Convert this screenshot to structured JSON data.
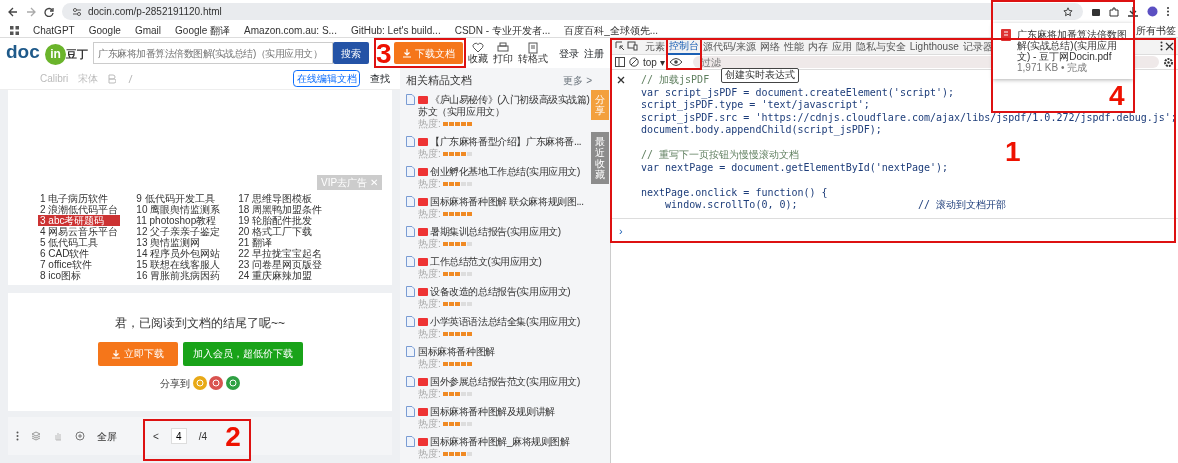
{
  "browser": {
    "url": "docin.com/p-2852191120.html",
    "bookmarks": [
      "ChatGPT",
      "Google",
      "Gmail",
      "Google 翻译",
      "Amazon.com.au: S...",
      "GitHub: Let's build...",
      "CSDN - 专业开发者...",
      "百度百科_全球领先..."
    ],
    "all_bookmarks": "所有书签"
  },
  "download_popup": {
    "file": "广东麻将加番算法倍数图解(实战总结)(实用应用文) - 豆丁网Docin.pdf",
    "status": "1,971 KB • 完成"
  },
  "site": {
    "logo_text": "doc",
    "logo_badge": "in",
    "logo_cn": "豆丁",
    "search": {
      "placeholder": "广东麻将加番算法倍数图解(实战总结)（实用应用文）"
    },
    "search_button": "搜索",
    "download_button": "下载文档",
    "actions": [
      "收藏",
      "打印",
      "转格式"
    ],
    "login": "登录",
    "register": "注册",
    "editor": {
      "font": "Calibri",
      "font_cn": "宋体",
      "edit_button": "在线编辑文档",
      "find": "查找"
    },
    "links": [
      {
        "num": "1",
        "text": "电子病历软件",
        "selected": false
      },
      {
        "num": "2",
        "text": "浪潮低代码平台",
        "selected": false
      },
      {
        "num": "3",
        "text": "abc考研题码",
        "selected": true
      },
      {
        "num": "4",
        "text": "网易云音乐平台",
        "selected": false
      },
      {
        "num": "5",
        "text": "低代码工具",
        "selected": false
      },
      {
        "num": "6",
        "text": "CAD软件",
        "selected": false
      },
      {
        "num": "7",
        "text": "office软件",
        "selected": false
      },
      {
        "num": "8",
        "text": "ico图标",
        "selected": false
      },
      {
        "num": "9",
        "text": "低代码开发工具",
        "selected": false
      },
      {
        "num": "10",
        "text": "鹰眼舆情监测系",
        "selected": false
      },
      {
        "num": "11",
        "text": "photoshop教程",
        "selected": false
      },
      {
        "num": "12",
        "text": "父子亲亲子鉴定",
        "selected": false
      },
      {
        "num": "13",
        "text": "舆情监测网",
        "selected": false
      },
      {
        "num": "14",
        "text": "程序员外包网站",
        "selected": false
      },
      {
        "num": "15",
        "text": "联想在线客服人",
        "selected": false
      },
      {
        "num": "16",
        "text": "胃胀前兆病因药",
        "selected": false
      },
      {
        "num": "17",
        "text": "思维导图模板",
        "selected": false
      },
      {
        "num": "18",
        "text": "周黑鸭加盟条件",
        "selected": false
      },
      {
        "num": "19",
        "text": "轮胎配件批发",
        "selected": false
      },
      {
        "num": "20",
        "text": "格式工厂下载",
        "selected": false
      },
      {
        "num": "21",
        "text": "翻译",
        "selected": false
      },
      {
        "num": "22",
        "text": "早拉拢宝宝起名",
        "selected": false
      },
      {
        "num": "23",
        "text": "问卷星网页版登",
        "selected": false
      },
      {
        "num": "24",
        "text": "重庆麻辣加盟",
        "selected": false
      }
    ],
    "ad_label": "VIP去广告 ✕",
    "end_message": "君，已阅读到文档的结尾了呢~~",
    "download_now": "立即下载",
    "vip_download": "加入会员，超低价下载",
    "share_label": "分享到",
    "pager": {
      "fullscreen": "全屏",
      "prev": "<",
      "page": "4",
      "total": "/4"
    },
    "related": {
      "title": "相关精品文档",
      "more": "更多 >",
      "items": [
        {
          "title": "《庐山易秘传》(入门初级高级实战篇)苏文（实用应用文）",
          "tagged": true,
          "heat_label": "热度:",
          "stars": 5
        },
        {
          "title": "【广东麻将番型介绍】广东麻将番...",
          "tagged": true,
          "heat_label": "热度:",
          "stars": 4
        },
        {
          "title": "创业孵化基地工作总结(实用应用文)",
          "tagged": true,
          "heat_label": "热度:",
          "stars": 3
        },
        {
          "title": "国标麻将番种图解 联众麻将规则图...",
          "tagged": true,
          "heat_label": "热度:",
          "stars": 5
        },
        {
          "title": "暑期集训总结报告(实用应用文)",
          "tagged": true,
          "heat_label": "热度:",
          "stars": 4
        },
        {
          "title": "工作总结范文(实用应用文)",
          "tagged": true,
          "heat_label": "热度:",
          "stars": 3
        },
        {
          "title": "设备改造的总结报告(实用应用文)",
          "tagged": true,
          "heat_label": "热度:",
          "stars": 3
        },
        {
          "title": "小学英语语法总结全集(实用应用文)",
          "tagged": true,
          "heat_label": "热度:",
          "stars": 5
        },
        {
          "title": "国标麻将番种图解",
          "tagged": false,
          "heat_label": "热度:",
          "stars": 5
        },
        {
          "title": "国外参展总结报告范文(实用应用文)",
          "tagged": true,
          "heat_label": "热度:",
          "stars": 3
        },
        {
          "title": "国标麻将番种图解及规则讲解",
          "tagged": true,
          "heat_label": "热度:",
          "stars": 3
        },
        {
          "title": "国标麻将番种图解_麻将规则图解",
          "tagged": true,
          "heat_label": "热度:",
          "stars": 4
        }
      ]
    },
    "side_tabs": [
      "分享",
      "最近收藏"
    ]
  },
  "devtools": {
    "tabs": [
      {
        "label": "元素",
        "selected": false
      },
      {
        "label": "控制台",
        "selected": true
      },
      {
        "label": "源代码/来源",
        "selected": false
      },
      {
        "label": "网络",
        "selected": false
      },
      {
        "label": "性能",
        "selected": false
      },
      {
        "label": "内存",
        "selected": false
      },
      {
        "label": "应用",
        "selected": false
      },
      {
        "label": "隐私与安全",
        "selected": false
      },
      {
        "label": "Lighthouse",
        "selected": false
      },
      {
        "label": "记录器",
        "selected": false
      }
    ],
    "context": "top ▾",
    "filter_placeholder": "过滤",
    "tooltip": "创建实时表达式",
    "code": [
      {
        "kind": "comment",
        "text": "// 加载jsPDF"
      },
      {
        "kind": "code",
        "text": "var script_jsPDF = document.createElement('script');"
      },
      {
        "kind": "code",
        "text": "script_jsPDF.type = 'text/javascript';"
      },
      {
        "kind": "code",
        "text": "script_jsPDF.src = 'https://cdnjs.cloudflare.com/ajax/libs/jspdf/1.0.272/jspdf.debug.js';"
      },
      {
        "kind": "code",
        "text": "document.body.appendChild(script_jsPDF);"
      },
      {
        "kind": "blank"
      },
      {
        "kind": "comment",
        "text": "// 重写下一页按钮为慢慢滚动文档"
      },
      {
        "kind": "code",
        "text": "var nextPage = document.getElementById('nextPage');"
      },
      {
        "kind": "blank"
      },
      {
        "kind": "code",
        "text": "nextPage.onclick = function() {"
      },
      {
        "kind": "code",
        "text": "    window.scrollTo(0, 0);                    // 滚动到文档开部"
      }
    ],
    "prompt": "›"
  },
  "annotations": [
    {
      "kind": "numbered",
      "label": "1"
    },
    {
      "kind": "numbered",
      "label": "2"
    },
    {
      "kind": "numbered",
      "label": "3"
    },
    {
      "kind": "numbered",
      "label": "4"
    },
    {
      "kind": "plain"
    }
  ]
}
